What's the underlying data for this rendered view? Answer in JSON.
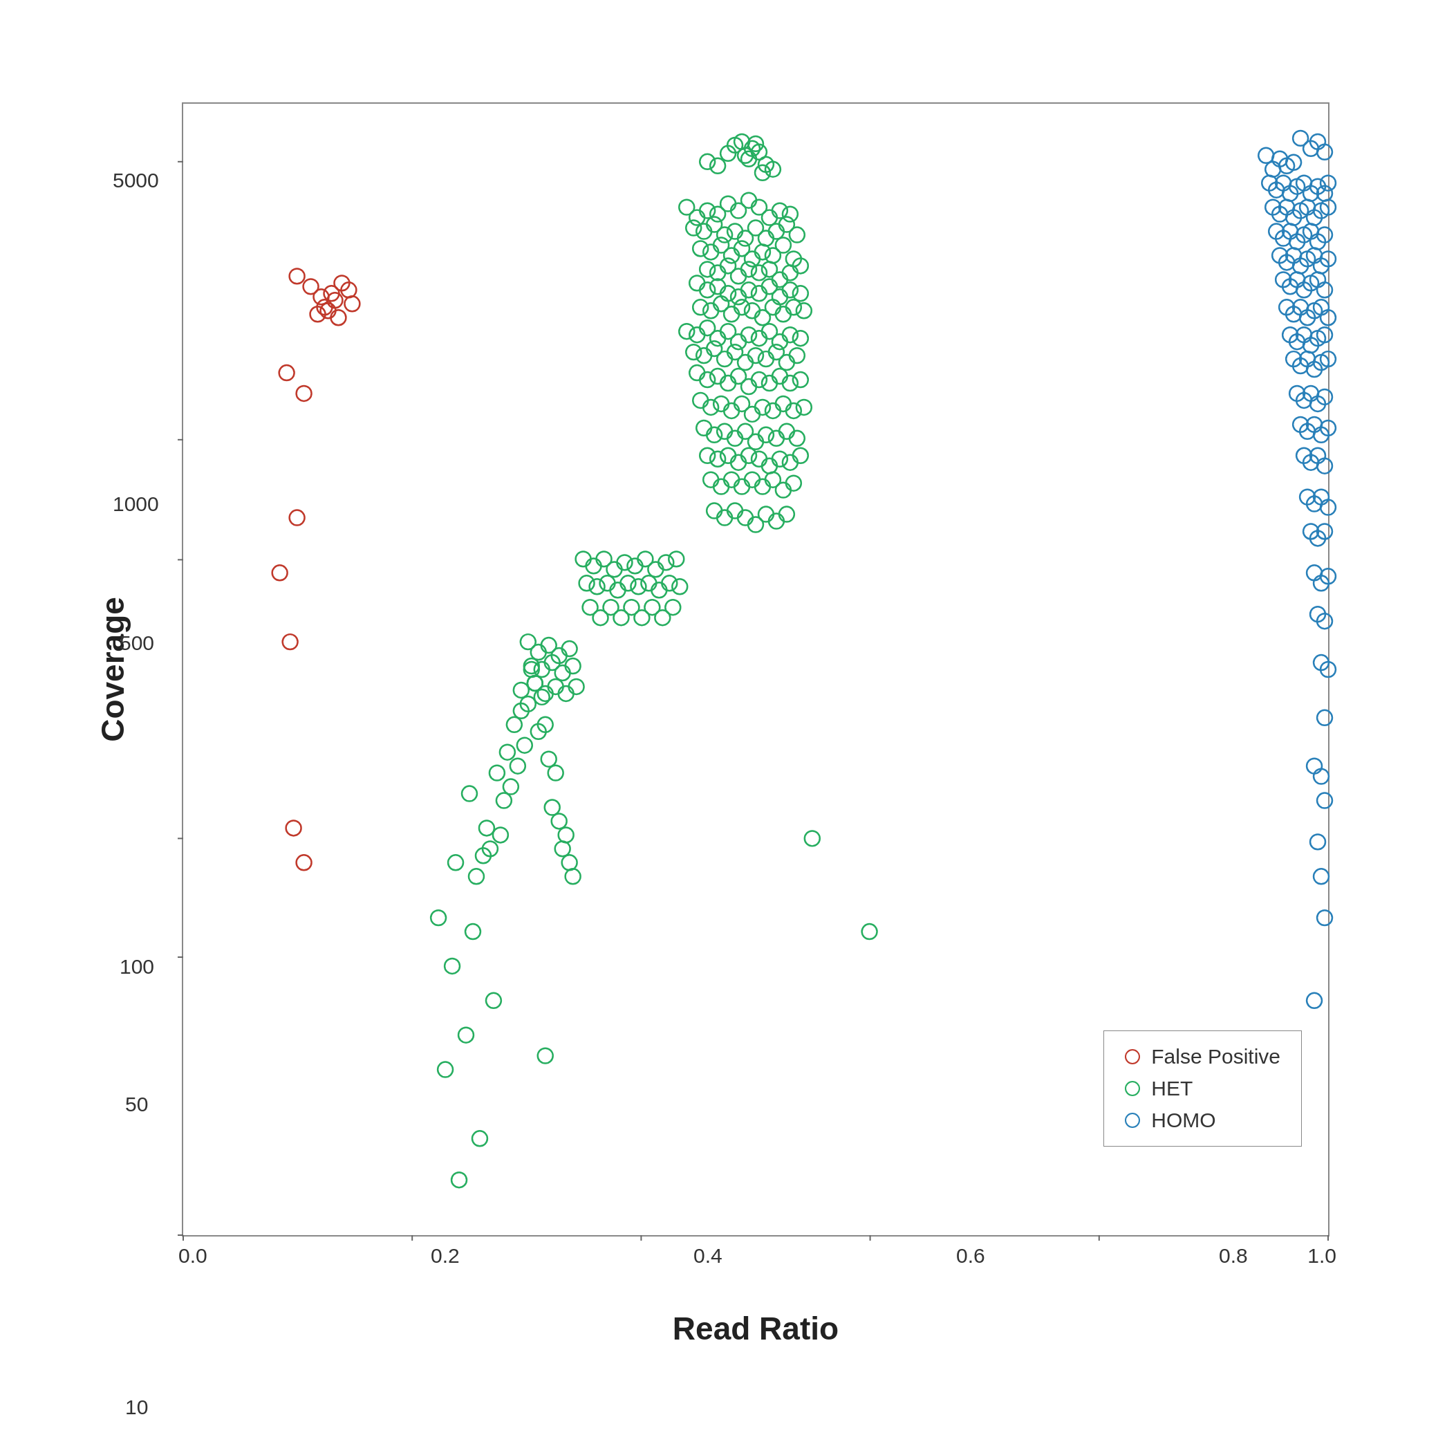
{
  "chart": {
    "title": "",
    "x_axis_label": "Read Ratio",
    "y_axis_label": "Coverage",
    "x_ticks": [
      "0.0",
      "0.2",
      "0.4",
      "0.6",
      "0.8",
      "1.0"
    ],
    "y_ticks": [
      "10",
      "50",
      "100",
      "500",
      "1000",
      "5000"
    ],
    "legend": {
      "items": [
        {
          "label": "False Positive",
          "color": "#c0392b",
          "class": "false-positive"
        },
        {
          "label": "HET",
          "color": "#27ae60",
          "class": "het"
        },
        {
          "label": "HOMO",
          "color": "#2980b9",
          "class": "homo"
        }
      ]
    }
  }
}
